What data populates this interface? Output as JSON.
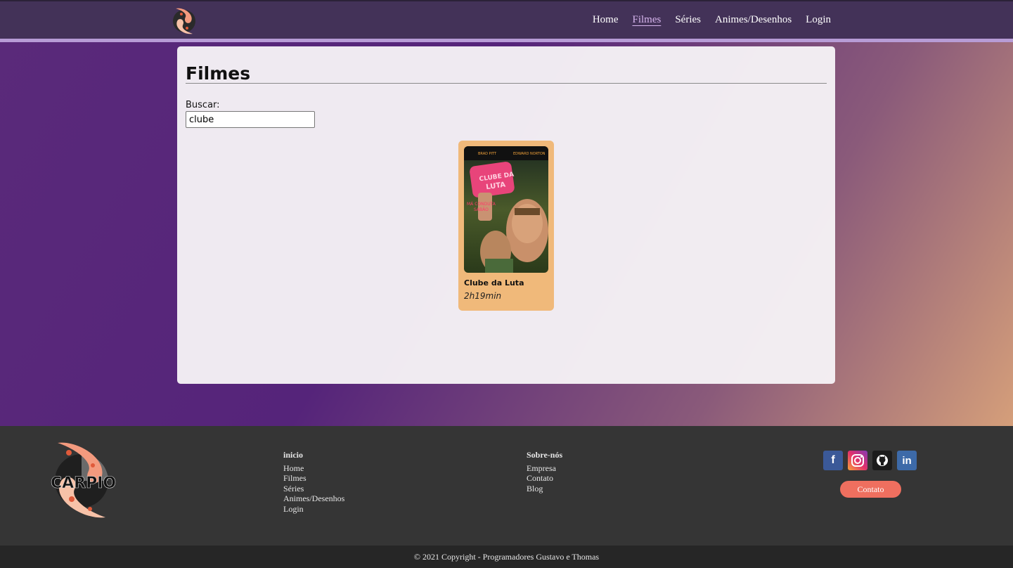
{
  "nav": {
    "items": [
      {
        "label": "Home",
        "active": false
      },
      {
        "label": "Filmes",
        "active": true
      },
      {
        "label": "Séries",
        "active": false
      },
      {
        "label": "Animes/Desenhos",
        "active": false
      },
      {
        "label": "Login",
        "active": false
      }
    ]
  },
  "main": {
    "title": "Filmes",
    "search_label": "Buscar:",
    "search_value": "clube",
    "results": [
      {
        "title": "Clube da Luta",
        "duration": "2h19min",
        "poster_text": "CLUBE DA LUTA"
      }
    ]
  },
  "footer": {
    "logo_text": "CARPIO",
    "col1": {
      "heading": "inicio",
      "links": [
        "Home",
        "Filmes",
        "Séries",
        "Animes/Desenhos",
        "Login"
      ]
    },
    "col2": {
      "heading": "Sobre-nós",
      "links": [
        "Empresa",
        "Contato",
        "Blog"
      ]
    },
    "social": [
      "facebook",
      "instagram",
      "github",
      "linkedin"
    ],
    "contact_button": "Contato",
    "copyright": "© 2021 Copyright - Programadores Gustavo e Thomas"
  },
  "colors": {
    "topbar": "#433258",
    "card": "#f0b97a",
    "footer": "#353535",
    "contact_button": "#ef6f5f"
  }
}
